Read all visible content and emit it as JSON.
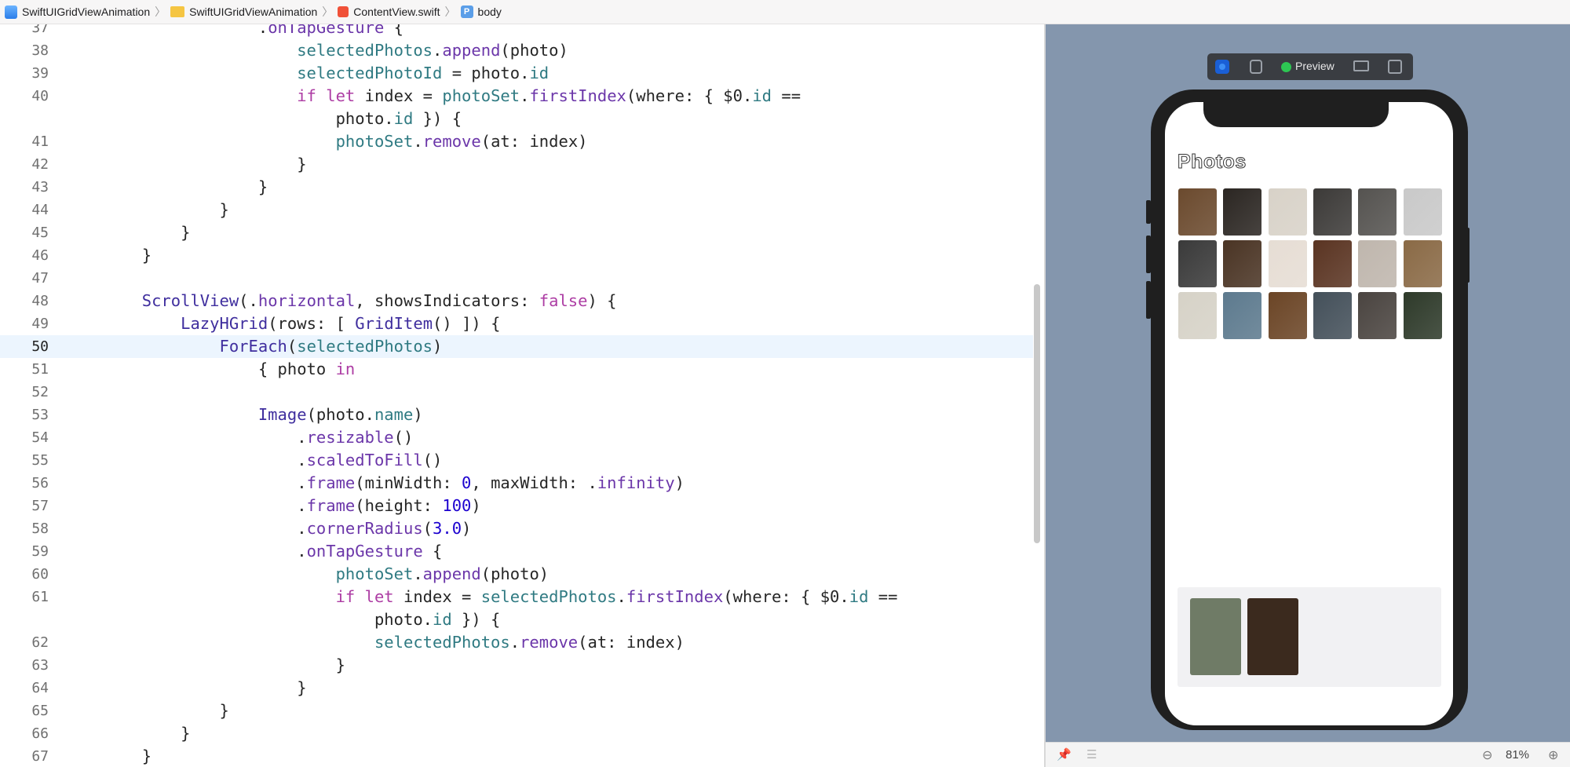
{
  "breadcrumb": {
    "project": "SwiftUIGridViewAnimation",
    "folder": "SwiftUIGridViewAnimation",
    "file": "ContentView.swift",
    "symbol_badge": "P",
    "symbol": "body"
  },
  "editor": {
    "highlighted_line": "50",
    "lines": [
      {
        "n": "37",
        "tokens": [
          {
            "t": "                    .",
            "c": "plain"
          },
          {
            "t": "onTapGesture",
            "c": "mt"
          },
          {
            "t": " {",
            "c": "plain"
          }
        ]
      },
      {
        "n": "38",
        "tokens": [
          {
            "t": "                        ",
            "c": "plain"
          },
          {
            "t": "selectedPhotos",
            "c": "pr"
          },
          {
            "t": ".",
            "c": "plain"
          },
          {
            "t": "append",
            "c": "mt"
          },
          {
            "t": "(photo)",
            "c": "plain"
          }
        ]
      },
      {
        "n": "39",
        "tokens": [
          {
            "t": "                        ",
            "c": "plain"
          },
          {
            "t": "selectedPhotoId",
            "c": "pr"
          },
          {
            "t": " = photo.",
            "c": "plain"
          },
          {
            "t": "id",
            "c": "pr"
          }
        ]
      },
      {
        "n": "40",
        "tokens": [
          {
            "t": "                        ",
            "c": "plain"
          },
          {
            "t": "if",
            "c": "kw"
          },
          {
            "t": " ",
            "c": "plain"
          },
          {
            "t": "let",
            "c": "kw"
          },
          {
            "t": " index = ",
            "c": "plain"
          },
          {
            "t": "photoSet",
            "c": "pr"
          },
          {
            "t": ".",
            "c": "plain"
          },
          {
            "t": "firstIndex",
            "c": "mt"
          },
          {
            "t": "(where: { $0.",
            "c": "plain"
          },
          {
            "t": "id",
            "c": "pr"
          },
          {
            "t": " ==",
            "c": "plain"
          }
        ]
      },
      {
        "n": "",
        "tokens": [
          {
            "t": "                            photo.",
            "c": "plain"
          },
          {
            "t": "id",
            "c": "pr"
          },
          {
            "t": " }) {",
            "c": "plain"
          }
        ]
      },
      {
        "n": "41",
        "tokens": [
          {
            "t": "                            ",
            "c": "plain"
          },
          {
            "t": "photoSet",
            "c": "pr"
          },
          {
            "t": ".",
            "c": "plain"
          },
          {
            "t": "remove",
            "c": "mt"
          },
          {
            "t": "(at: index)",
            "c": "plain"
          }
        ]
      },
      {
        "n": "42",
        "tokens": [
          {
            "t": "                        }",
            "c": "plain"
          }
        ]
      },
      {
        "n": "43",
        "tokens": [
          {
            "t": "                    }",
            "c": "plain"
          }
        ]
      },
      {
        "n": "44",
        "tokens": [
          {
            "t": "                }",
            "c": "plain"
          }
        ]
      },
      {
        "n": "45",
        "tokens": [
          {
            "t": "            }",
            "c": "plain"
          }
        ]
      },
      {
        "n": "46",
        "tokens": [
          {
            "t": "        }",
            "c": "plain"
          }
        ]
      },
      {
        "n": "47",
        "tokens": [
          {
            "t": "",
            "c": "plain"
          }
        ]
      },
      {
        "n": "48",
        "tokens": [
          {
            "t": "        ",
            "c": "plain"
          },
          {
            "t": "ScrollView",
            "c": "ty"
          },
          {
            "t": "(.",
            "c": "plain"
          },
          {
            "t": "horizontal",
            "c": "mt"
          },
          {
            "t": ", showsIndicators: ",
            "c": "plain"
          },
          {
            "t": "false",
            "c": "kw"
          },
          {
            "t": ") {",
            "c": "plain"
          }
        ]
      },
      {
        "n": "49",
        "tokens": [
          {
            "t": "            ",
            "c": "plain"
          },
          {
            "t": "LazyHGrid",
            "c": "ty"
          },
          {
            "t": "(rows: [ ",
            "c": "plain"
          },
          {
            "t": "GridItem",
            "c": "ty"
          },
          {
            "t": "() ]) {",
            "c": "plain"
          }
        ]
      },
      {
        "n": "50",
        "tokens": [
          {
            "t": "                ",
            "c": "plain"
          },
          {
            "t": "ForEach",
            "c": "ty"
          },
          {
            "t": "(",
            "c": "plain"
          },
          {
            "t": "selectedPhotos",
            "c": "pr"
          },
          {
            "t": ")",
            "c": "plain"
          }
        ]
      },
      {
        "n": "51",
        "tokens": [
          {
            "t": "                    { photo ",
            "c": "plain"
          },
          {
            "t": "in",
            "c": "kw"
          }
        ]
      },
      {
        "n": "52",
        "tokens": [
          {
            "t": "",
            "c": "plain"
          }
        ]
      },
      {
        "n": "53",
        "tokens": [
          {
            "t": "                    ",
            "c": "plain"
          },
          {
            "t": "Image",
            "c": "ty"
          },
          {
            "t": "(photo.",
            "c": "plain"
          },
          {
            "t": "name",
            "c": "pr"
          },
          {
            "t": ")",
            "c": "plain"
          }
        ]
      },
      {
        "n": "54",
        "tokens": [
          {
            "t": "                        .",
            "c": "plain"
          },
          {
            "t": "resizable",
            "c": "mt"
          },
          {
            "t": "()",
            "c": "plain"
          }
        ]
      },
      {
        "n": "55",
        "tokens": [
          {
            "t": "                        .",
            "c": "plain"
          },
          {
            "t": "scaledToFill",
            "c": "mt"
          },
          {
            "t": "()",
            "c": "plain"
          }
        ]
      },
      {
        "n": "56",
        "tokens": [
          {
            "t": "                        .",
            "c": "plain"
          },
          {
            "t": "frame",
            "c": "mt"
          },
          {
            "t": "(minWidth: ",
            "c": "plain"
          },
          {
            "t": "0",
            "c": "nm"
          },
          {
            "t": ", maxWidth: .",
            "c": "plain"
          },
          {
            "t": "infinity",
            "c": "mt"
          },
          {
            "t": ")",
            "c": "plain"
          }
        ]
      },
      {
        "n": "57",
        "tokens": [
          {
            "t": "                        .",
            "c": "plain"
          },
          {
            "t": "frame",
            "c": "mt"
          },
          {
            "t": "(height: ",
            "c": "plain"
          },
          {
            "t": "100",
            "c": "nm"
          },
          {
            "t": ")",
            "c": "plain"
          }
        ]
      },
      {
        "n": "58",
        "tokens": [
          {
            "t": "                        .",
            "c": "plain"
          },
          {
            "t": "cornerRadius",
            "c": "mt"
          },
          {
            "t": "(",
            "c": "plain"
          },
          {
            "t": "3.0",
            "c": "nm"
          },
          {
            "t": ")",
            "c": "plain"
          }
        ]
      },
      {
        "n": "59",
        "tokens": [
          {
            "t": "                        .",
            "c": "plain"
          },
          {
            "t": "onTapGesture",
            "c": "mt"
          },
          {
            "t": " {",
            "c": "plain"
          }
        ]
      },
      {
        "n": "60",
        "tokens": [
          {
            "t": "                            ",
            "c": "plain"
          },
          {
            "t": "photoSet",
            "c": "pr"
          },
          {
            "t": ".",
            "c": "plain"
          },
          {
            "t": "append",
            "c": "mt"
          },
          {
            "t": "(photo)",
            "c": "plain"
          }
        ]
      },
      {
        "n": "61",
        "tokens": [
          {
            "t": "                            ",
            "c": "plain"
          },
          {
            "t": "if",
            "c": "kw"
          },
          {
            "t": " ",
            "c": "plain"
          },
          {
            "t": "let",
            "c": "kw"
          },
          {
            "t": " index = ",
            "c": "plain"
          },
          {
            "t": "selectedPhotos",
            "c": "pr"
          },
          {
            "t": ".",
            "c": "plain"
          },
          {
            "t": "firstIndex",
            "c": "mt"
          },
          {
            "t": "(where: { $0.",
            "c": "plain"
          },
          {
            "t": "id",
            "c": "pr"
          },
          {
            "t": " ==",
            "c": "plain"
          }
        ]
      },
      {
        "n": "",
        "tokens": [
          {
            "t": "                                photo.",
            "c": "plain"
          },
          {
            "t": "id",
            "c": "pr"
          },
          {
            "t": " }) {",
            "c": "plain"
          }
        ]
      },
      {
        "n": "62",
        "tokens": [
          {
            "t": "                                ",
            "c": "plain"
          },
          {
            "t": "selectedPhotos",
            "c": "pr"
          },
          {
            "t": ".",
            "c": "plain"
          },
          {
            "t": "remove",
            "c": "mt"
          },
          {
            "t": "(at: index)",
            "c": "plain"
          }
        ]
      },
      {
        "n": "63",
        "tokens": [
          {
            "t": "                            }",
            "c": "plain"
          }
        ]
      },
      {
        "n": "64",
        "tokens": [
          {
            "t": "                        }",
            "c": "plain"
          }
        ]
      },
      {
        "n": "65",
        "tokens": [
          {
            "t": "                }",
            "c": "plain"
          }
        ]
      },
      {
        "n": "66",
        "tokens": [
          {
            "t": "            }",
            "c": "plain"
          }
        ]
      },
      {
        "n": "67",
        "tokens": [
          {
            "t": "        }",
            "c": "plain"
          }
        ]
      }
    ]
  },
  "preview": {
    "toolbar_label": "Preview",
    "status_color": "#2dc653",
    "icons": [
      "live-preview-icon",
      "selectable-icon",
      "device-settings-icon",
      "duplicate-icon"
    ],
    "app_title": "Photos",
    "grid_photo_colors": [
      "#6b4a2e",
      "#2b2622",
      "#d8d2c8",
      "#3c3a38",
      "#555350",
      "#c9c9c9",
      "#3a3a3a",
      "#4a3424",
      "#e6ddd4",
      "#5a3422",
      "#bfb6ad",
      "#8a6a46",
      "#d6d2c7",
      "#5d7a8e",
      "#6b4526",
      "#44505a",
      "#4a4440",
      "#2e3a2a"
    ],
    "tray_photo_colors": [
      "#6f7b66",
      "#3b2a1e"
    ]
  },
  "canvas_footer": {
    "zoom": "81%",
    "icons": [
      "pin-icon",
      "list-icon",
      "zoom-out-icon",
      "zoom-in-icon"
    ]
  },
  "colors": {
    "canvas_bg": "#8496ad",
    "highlight_line": "#ecf5fe",
    "keyword": "#ad3da4",
    "type": "#3f2e9e",
    "property": "#2f7a82",
    "method": "#6b36a9",
    "number": "#1c00cf"
  }
}
